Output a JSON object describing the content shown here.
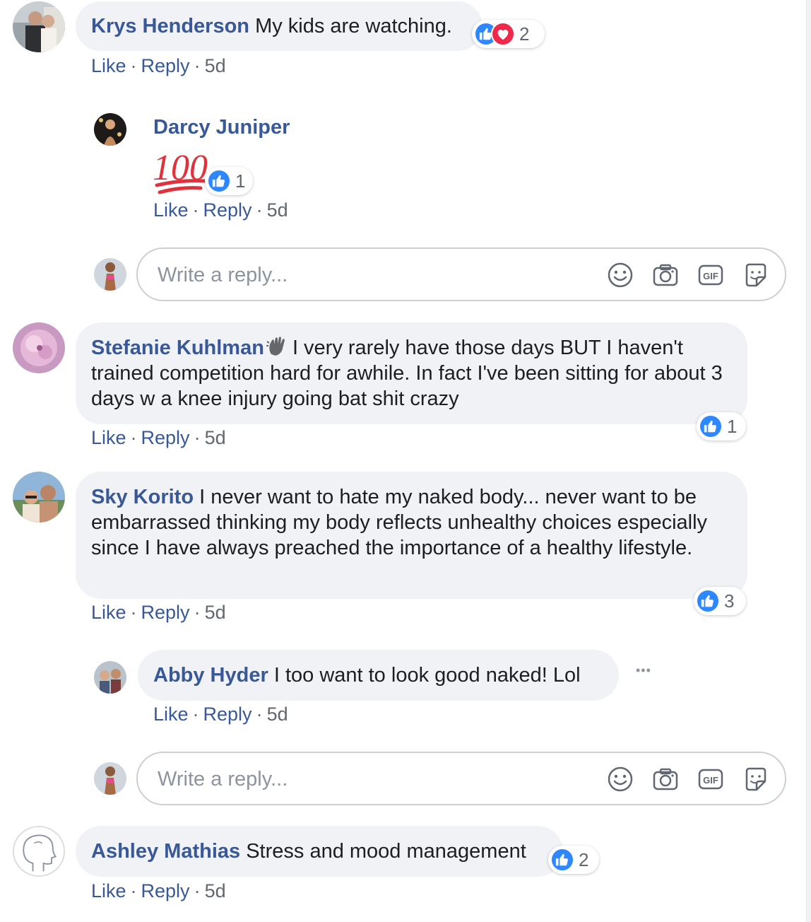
{
  "actions": {
    "like": "Like",
    "reply": "Reply",
    "sep": "·"
  },
  "comments": [
    {
      "author": "Krys Henderson",
      "text": "My kids are watching.",
      "time": "5d",
      "reactions": 2
    },
    {
      "author": "Darcy Juniper",
      "sticker": "100",
      "time": "5d",
      "reactions": 1
    },
    {
      "author": "Stefanie Kuhlman",
      "text": "I very rarely have those days BUT I haven't trained competition hard for awhile. In fact I've been sitting for about 3 days w a knee injury going bat shit crazy",
      "time": "5d",
      "reactions": 1
    },
    {
      "author": "Sky Korito",
      "text": "I never want to hate my naked body... never want to be embarrassed thinking my body reflects unhealthy choices especially since I have always preached the importance of a healthy lifestyle.",
      "time": "5d",
      "reactions": 3
    },
    {
      "author": "Abby Hyder",
      "text": "I too want to look good naked! Lol",
      "time": "5d",
      "more": "•••"
    },
    {
      "author": "Ashley Mathias",
      "text": "Stress and mood management",
      "time": "5d",
      "reactions": 2
    }
  ],
  "reply_box": {
    "placeholder": "Write a reply..."
  },
  "colors": {
    "link": "#385898",
    "bubble": "#f0f2f5",
    "like": "#2d88ff",
    "love": "#f0284a"
  }
}
